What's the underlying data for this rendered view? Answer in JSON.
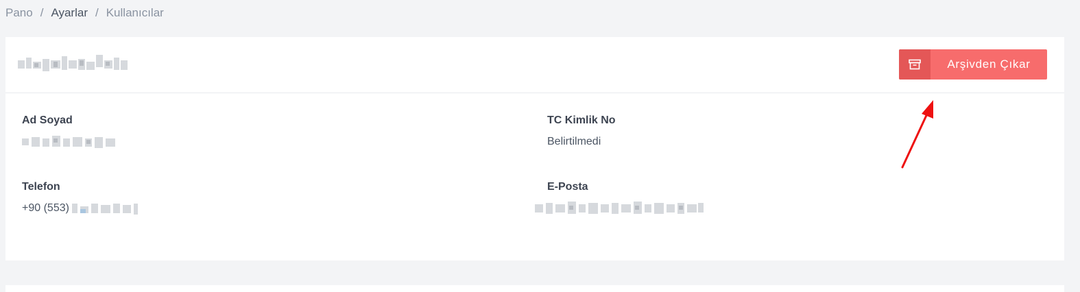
{
  "breadcrumb": {
    "items": [
      "Pano",
      "Ayarlar",
      "Kullanıcılar"
    ],
    "separator": "/"
  },
  "header": {
    "archive_button_label": "Arşivden Çıkar",
    "archive_icon": "archive-box-icon"
  },
  "fields": {
    "name": {
      "label": "Ad Soyad"
    },
    "tc": {
      "label": "TC Kimlik No",
      "value": "Belirtilmedi"
    },
    "phone": {
      "label": "Telefon",
      "value_prefix": "+90 (553)"
    },
    "email": {
      "label": "E-Posta"
    }
  },
  "colors": {
    "button": "#f76c6c",
    "button_icon_bg": "#e45757",
    "annotation_arrow": "#ee1111",
    "background": "#f3f4f6"
  }
}
